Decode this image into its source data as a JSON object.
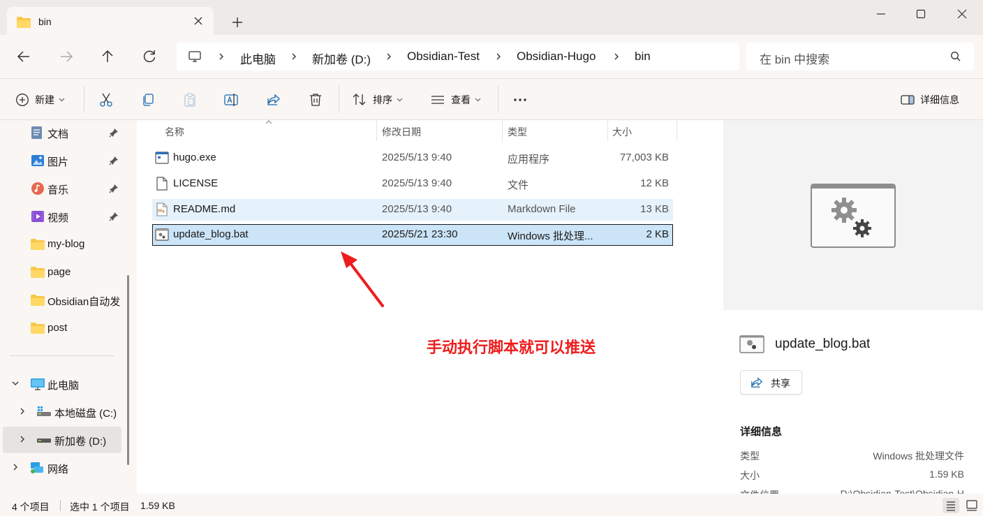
{
  "window": {
    "tab_title": "bin"
  },
  "address": {
    "breadcrumbs": [
      "此电脑",
      "新加卷 (D:)",
      "Obsidian-Test",
      "Obsidian-Hugo",
      "bin"
    ],
    "search_placeholder": "在 bin 中搜索"
  },
  "toolbar": {
    "new_label": "新建",
    "sort_label": "排序",
    "view_label": "查看",
    "details_label": "详细信息"
  },
  "sidebar": {
    "quick_access": [
      {
        "label": "文档",
        "icon": "documents-icon",
        "pinned": true
      },
      {
        "label": "图片",
        "icon": "pictures-icon",
        "pinned": true
      },
      {
        "label": "音乐",
        "icon": "music-icon",
        "pinned": true
      },
      {
        "label": "视频",
        "icon": "videos-icon",
        "pinned": true
      },
      {
        "label": "my-blog",
        "icon": "folder-icon",
        "pinned": false
      },
      {
        "label": "page",
        "icon": "folder-icon",
        "pinned": false
      },
      {
        "label": "Obsidian自动发",
        "icon": "folder-icon",
        "pinned": false
      },
      {
        "label": "post",
        "icon": "folder-icon",
        "pinned": false
      }
    ],
    "this_pc": "此电脑",
    "drives": [
      {
        "label": "本地磁盘 (C:)",
        "icon": "drive-c-icon"
      },
      {
        "label": "新加卷 (D:)",
        "icon": "drive-d-icon"
      }
    ],
    "network": "网络"
  },
  "filelist": {
    "columns": [
      "名称",
      "修改日期",
      "类型",
      "大小"
    ],
    "rows": [
      {
        "name": "hugo.exe",
        "date": "2025/5/13 9:40",
        "type": "应用程序",
        "size": "77,003 KB",
        "icon": "exe-icon"
      },
      {
        "name": "LICENSE",
        "date": "2025/5/13 9:40",
        "type": "文件",
        "size": "12 KB",
        "icon": "file-icon"
      },
      {
        "name": "README.md",
        "date": "2025/5/13 9:40",
        "type": "Markdown File",
        "size": "13 KB",
        "icon": "markdown-icon"
      },
      {
        "name": "update_blog.bat",
        "date": "2025/5/21 23:30",
        "type": "Windows 批处理...",
        "size": "2 KB",
        "icon": "batch-file-icon"
      }
    ],
    "annotation": "手动执行脚本就可以推送"
  },
  "preview": {
    "filename": "update_blog.bat",
    "share_label": "共享",
    "details_title": "详细信息",
    "details": [
      {
        "key": "类型",
        "value": "Windows 批处理文件"
      },
      {
        "key": "大小",
        "value": "1.59 KB"
      },
      {
        "key": "文件位置",
        "value": "D:\\Obsidian-Test\\Obsidian-H"
      }
    ]
  },
  "status": {
    "item_count": "4 个项目",
    "selection": "选中 1 个项目",
    "selection_size": "1.59 KB"
  },
  "colors": {
    "selection_bg": "#cce4f7",
    "hover_bg": "#e5f1fb",
    "annotation_red": "#ee1c1c",
    "folder_yellow": "#f8c84a"
  }
}
